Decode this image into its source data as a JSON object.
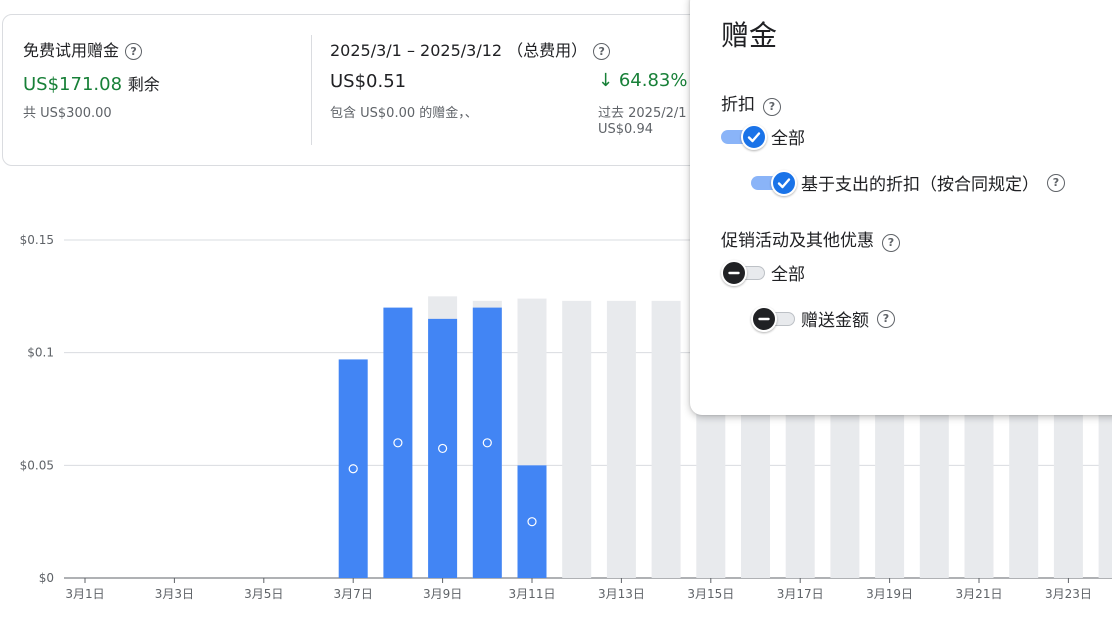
{
  "summary": {
    "card1": {
      "title": "免费试用赠金",
      "value": "US$171.08",
      "value_suffix": "剩余",
      "total": "共 US$300.00"
    },
    "card2": {
      "title": "2025/3/1 – 2025/3/12 （总费用）",
      "value": "US$0.51",
      "note": "包含 US$0.00 的赠金，、"
    },
    "card3": {
      "arrow": "↓",
      "percent": "64.83%",
      "compare_line1": "过去 2025/2/1",
      "compare_line2": "US$0.94"
    }
  },
  "panel": {
    "title": "赠金",
    "section1": "折扣",
    "toggle_all_1": "全部",
    "toggle_spend": "基于支出的折扣（按合同规定）",
    "section2": "促销活动及其他优惠",
    "toggle_all_2": "全部",
    "toggle_gift": "赠送金额"
  },
  "colors": {
    "actual": "#4285f4",
    "forecast": "#e8eaed",
    "positive": "#188038",
    "toggle_on": "#1a73e8"
  },
  "chart_data": {
    "type": "bar",
    "ylabel": "",
    "xlabel": "",
    "ylim": [
      0,
      0.15
    ],
    "y_ticks": [
      "$0",
      "$0.05",
      "$0.1",
      "$0.15"
    ],
    "y_tick_values": [
      0,
      0.05,
      0.1,
      0.15
    ],
    "x_tick_labels": [
      "3月1日",
      "3月3日",
      "3月5日",
      "3月7日",
      "3月9日",
      "3月11日",
      "3月13日",
      "3月15日",
      "3月17日",
      "3月19日",
      "3月21日",
      "3月23日"
    ],
    "categories": [
      "3月1日",
      "3月2日",
      "3月3日",
      "3月4日",
      "3月5日",
      "3月6日",
      "3月7日",
      "3月8日",
      "3月9日",
      "3月10日",
      "3月11日",
      "3月12日",
      "3月13日",
      "3月14日",
      "3月15日",
      "3月16日",
      "3月17日",
      "3月18日",
      "3月19日",
      "3月20日",
      "3月21日",
      "3月22日",
      "3月23日",
      "3月24日"
    ],
    "series": [
      {
        "name": "actual",
        "values": [
          0,
          0,
          0,
          0,
          0,
          0,
          0.097,
          0.12,
          0.115,
          0.12,
          0.05,
          null,
          null,
          null,
          null,
          null,
          null,
          null,
          null,
          null,
          null,
          null,
          null,
          null
        ]
      },
      {
        "name": "forecast",
        "values": [
          null,
          null,
          null,
          null,
          null,
          null,
          null,
          null,
          0.125,
          0.123,
          0.124,
          0.123,
          0.123,
          0.123,
          0.123,
          0.123,
          0.123,
          0.123,
          0.123,
          0.123,
          0.123,
          0.123,
          0.123,
          0.123
        ]
      }
    ]
  }
}
